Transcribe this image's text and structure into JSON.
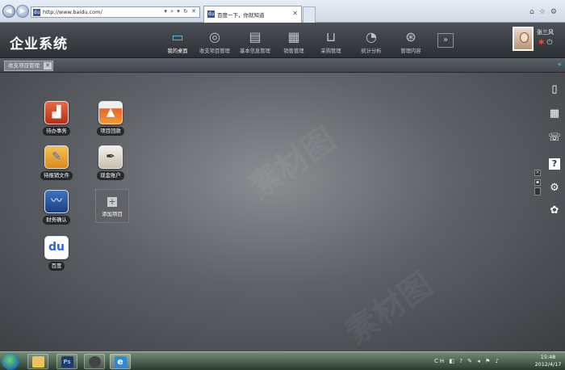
{
  "browser": {
    "address": "http://www.baidu.com/",
    "address_controls": "▾ ⌕ ▾ ↻ ✕",
    "tab_title": "百度一下，你就知道",
    "favicon": "du"
  },
  "app": {
    "title": "企业系统",
    "nav": [
      {
        "label": "我的桌面",
        "icon": "monitor-icon"
      },
      {
        "label": "收支项目管理",
        "icon": "coins-icon"
      },
      {
        "label": "基本信息管理",
        "icon": "id-card-icon"
      },
      {
        "label": "销售管理",
        "icon": "cash-register-icon"
      },
      {
        "label": "采购管理",
        "icon": "cart-icon"
      },
      {
        "label": "统计分析",
        "icon": "pie-chart-icon"
      },
      {
        "label": "管理内容",
        "icon": "steering-wheel-icon"
      }
    ],
    "more": "»",
    "user": {
      "name": "张三风"
    }
  },
  "tabstrip": {
    "active_tab": "收支项目管理"
  },
  "desktop": {
    "apps": [
      {
        "label": "待办事务",
        "icon": "bar-chart-icon",
        "color": "#d8452b"
      },
      {
        "label": "项目回款",
        "icon": "mountain-chart-icon",
        "color": "#e87a2a"
      },
      {
        "label": "待报销文件",
        "icon": "document-pen-icon",
        "color": "#e7a53a"
      },
      {
        "label": "现金账户",
        "icon": "notebook-pen-icon",
        "color": "#d9d2c4"
      },
      {
        "label": "财务确认",
        "icon": "line-chart-icon",
        "color": "#2c5ea8"
      },
      {
        "label": "百度",
        "icon": "baidu-paw-icon",
        "color": "#2e64d6"
      }
    ],
    "add_item": "添加项目",
    "watermark": "素材图"
  },
  "taskbar": {
    "apps": [
      {
        "name": "explorer",
        "icon": "folder-icon",
        "glyph": ""
      },
      {
        "name": "photoshop",
        "icon": "photoshop-icon",
        "glyph": "Ps"
      },
      {
        "name": "media",
        "icon": "media-player-icon",
        "glyph": ""
      },
      {
        "name": "internet-explorer",
        "icon": "ie-icon",
        "glyph": "e"
      }
    ],
    "tray": "CH ◧ ? ✎ ◂ ⚑ ♪",
    "time": "15:48",
    "date": "2012/4/17"
  }
}
